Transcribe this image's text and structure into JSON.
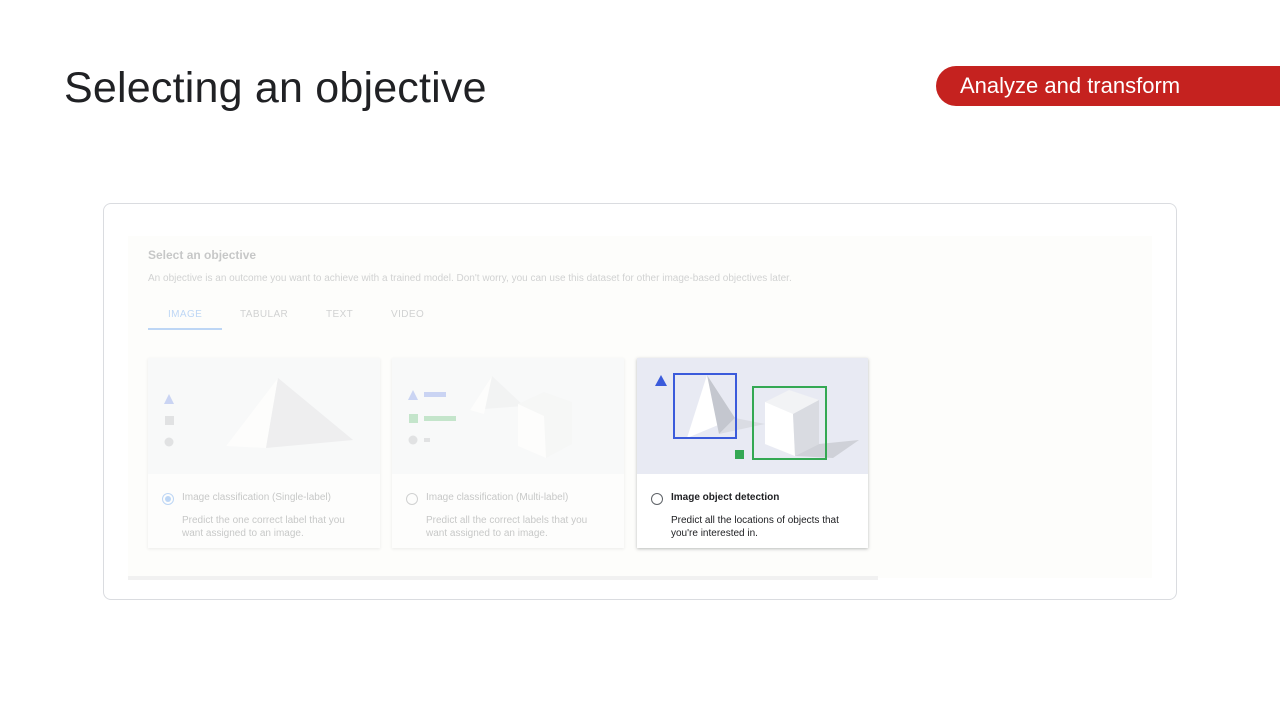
{
  "slide": {
    "title": "Selecting an objective",
    "section_tag": "Analyze and transform"
  },
  "dialog": {
    "heading": "Select an objective",
    "description": "An objective is an outcome you want to achieve with a trained model. Don't worry, you can use this dataset for other image-based objectives later.",
    "tabs": [
      {
        "label": "IMAGE",
        "active": true
      },
      {
        "label": "TABULAR",
        "active": false
      },
      {
        "label": "TEXT",
        "active": false
      },
      {
        "label": "VIDEO",
        "active": false
      }
    ],
    "cards": [
      {
        "title": "Image classification (Single-label)",
        "desc_line1": "Predict the one correct label that you",
        "desc_line2": "want assigned to an image.",
        "selected": true,
        "highlighted": false
      },
      {
        "title": "Image classification (Multi-label)",
        "desc_line1": "Predict all the correct labels that you",
        "desc_line2": "want assigned to an image.",
        "selected": false,
        "highlighted": false
      },
      {
        "title": "Image object detection",
        "desc_line1": "Predict all the locations of objects that",
        "desc_line2": "you're interested in.",
        "selected": false,
        "highlighted": true
      }
    ]
  },
  "colors": {
    "tag_red": "#c5221f",
    "accent_blue": "#1a73e8",
    "detect_green": "#34a853"
  }
}
